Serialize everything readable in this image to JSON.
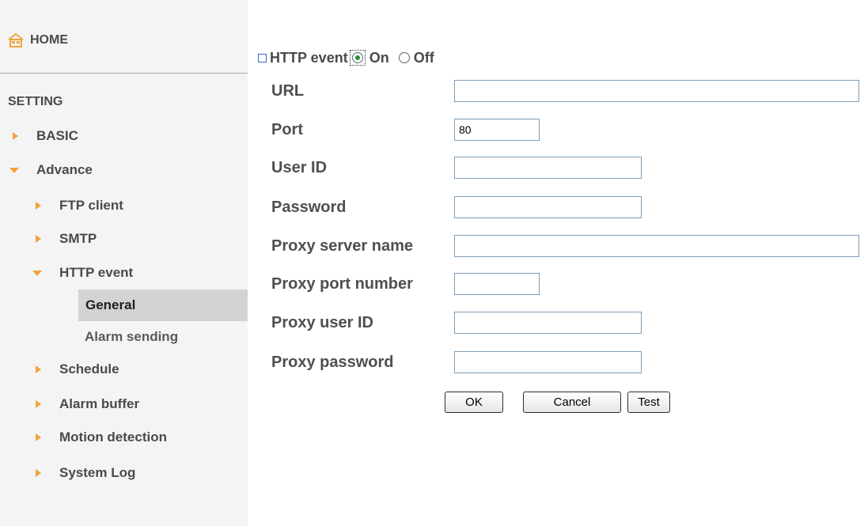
{
  "sidebar": {
    "home_label": "HOME",
    "setting_label": "SETTING",
    "items": {
      "basic": "BASIC",
      "advance": "Advance",
      "ftp_client": "FTP client",
      "smtp": "SMTP",
      "http_event": "HTTP event",
      "general": "General",
      "alarm_sending": "Alarm sending",
      "schedule": "Schedule",
      "alarm_buffer": "Alarm buffer",
      "motion_detection": "Motion detection",
      "system_log": "System Log"
    },
    "accent_color": "#f2a33c"
  },
  "main": {
    "header": {
      "title": "HTTP event",
      "on_label": "On",
      "off_label": "Off",
      "selected": "On"
    },
    "fields": {
      "url": {
        "label": "URL",
        "value": ""
      },
      "port": {
        "label": "Port",
        "value": "80"
      },
      "user_id": {
        "label": "User ID",
        "value": ""
      },
      "password": {
        "label": "Password",
        "value": ""
      },
      "proxy_server_name": {
        "label": "Proxy server name",
        "value": ""
      },
      "proxy_port_number": {
        "label": "Proxy port number",
        "value": ""
      },
      "proxy_user_id": {
        "label": "Proxy user ID",
        "value": ""
      },
      "proxy_password": {
        "label": "Proxy password",
        "value": ""
      }
    },
    "buttons": {
      "ok": "OK",
      "cancel": "Cancel",
      "test": "Test"
    }
  }
}
